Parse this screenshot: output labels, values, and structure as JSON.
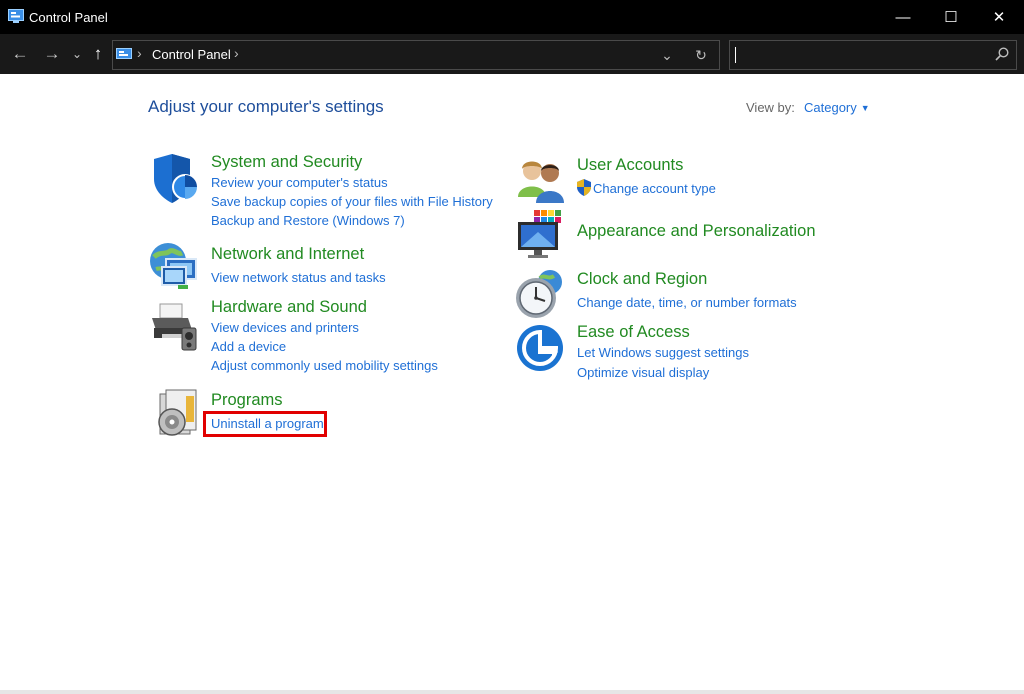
{
  "window": {
    "title": "Control Panel",
    "min_glyph": "—",
    "max_glyph": "☐",
    "close_glyph": "✕"
  },
  "nav": {
    "back_glyph": "←",
    "forward_glyph": "→",
    "recent_glyph": "⌄",
    "up_glyph": "↑",
    "breadcrumb": "Control Panel",
    "sep_glyph": "›",
    "dropdown_glyph": "⌄",
    "refresh_glyph": "↻",
    "search_value": "",
    "search_placeholder": ""
  },
  "main": {
    "heading": "Adjust your computer's settings",
    "view_by_label": "View by:",
    "view_by_value": "Category"
  },
  "left_categories": [
    {
      "title": "System and Security",
      "links": [
        "Review your computer's status",
        "Save backup copies of your files with File History",
        "Backup and Restore (Windows 7)"
      ]
    },
    {
      "title": "Network and Internet",
      "links": [
        "View network status and tasks"
      ]
    },
    {
      "title": "Hardware and Sound",
      "links": [
        "View devices and printers",
        "Add a device",
        "Adjust commonly used mobility settings"
      ]
    },
    {
      "title": "Programs",
      "links": [
        "Uninstall a program"
      ]
    }
  ],
  "right_categories": [
    {
      "title": "User Accounts",
      "links": [
        "Change account type"
      ]
    },
    {
      "title": "Appearance and Personalization",
      "links": []
    },
    {
      "title": "Clock and Region",
      "links": [
        "Change date, time, or number formats"
      ]
    },
    {
      "title": "Ease of Access",
      "links": [
        "Let Windows suggest settings",
        "Optimize visual display"
      ]
    }
  ],
  "colors": {
    "title_bar": "#000000",
    "nav_bar": "#191919",
    "category_title": "#218a21",
    "link": "#1f6fd6",
    "heading": "#1e4e9b",
    "highlight_box": "#e10000"
  }
}
